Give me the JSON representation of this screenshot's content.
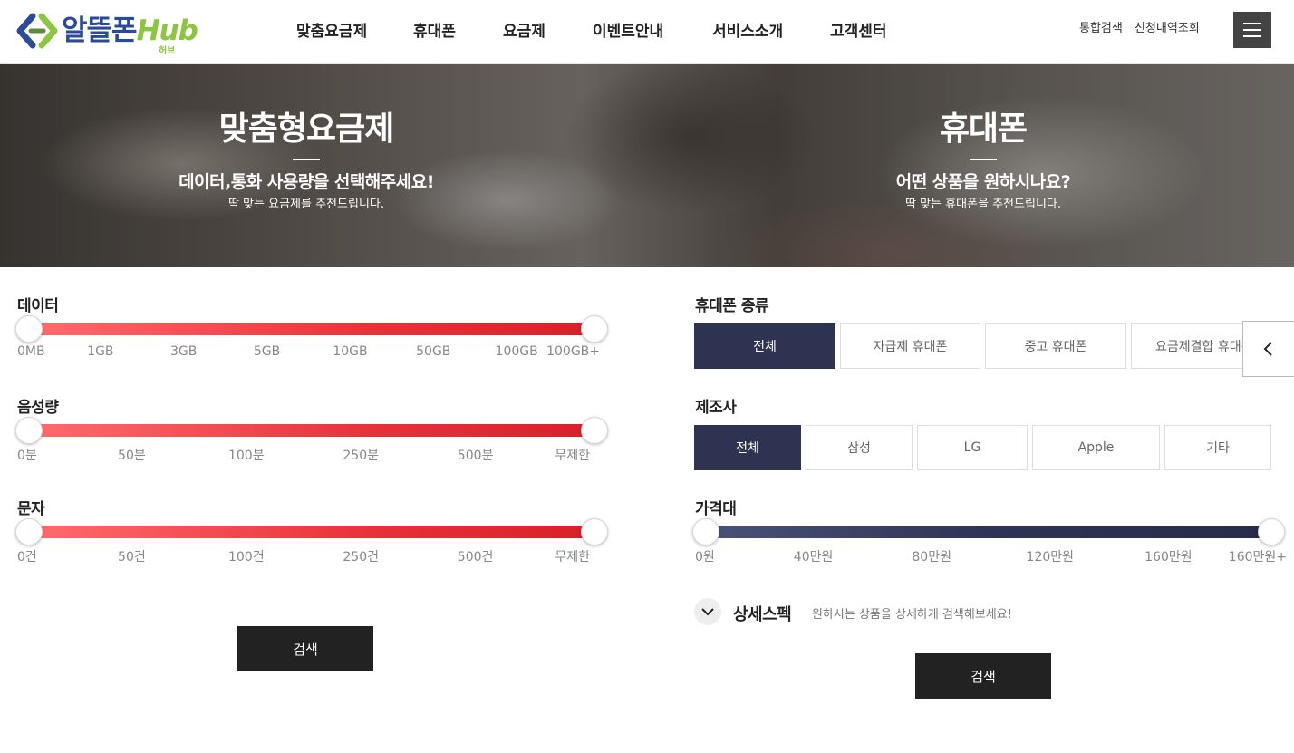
{
  "brand": {
    "name": "알뜰폰",
    "hub": "Hub",
    "sub": "허브"
  },
  "nav": [
    "맞춤요금제",
    "휴대폰",
    "요금제",
    "이벤트안내",
    "서비스소개",
    "고객센터"
  ],
  "util": {
    "search": "통합검색",
    "history": "신청내역조회"
  },
  "hero": {
    "left": {
      "title": "맞춤형요금제",
      "subtitle": "데이터,통화 사용량을 선택해주세요!",
      "desc": "딱 맞는 요금제를 추천드립니다."
    },
    "right": {
      "title": "휴대폰",
      "subtitle": "어떤 상품을 원하시나요?",
      "desc": "딱 맞는 휴대폰을 추천드립니다."
    }
  },
  "plan": {
    "data": {
      "label": "데이터",
      "ticks": [
        "0MB",
        "1GB",
        "3GB",
        "5GB",
        "10GB",
        "50GB",
        "100GB",
        "100GB+"
      ],
      "range": [
        0,
        1
      ]
    },
    "voice": {
      "label": "음성량",
      "ticks": [
        "0분",
        "50분",
        "100분",
        "250분",
        "500분",
        "무제한"
      ],
      "range": [
        0,
        1
      ]
    },
    "sms": {
      "label": "문자",
      "ticks": [
        "0건",
        "50건",
        "100건",
        "250건",
        "500건",
        "무제한"
      ],
      "range": [
        0,
        1
      ]
    },
    "search_label": "검색"
  },
  "phone": {
    "type": {
      "label": "휴대폰 종류",
      "options": [
        "전체",
        "자급제 휴대폰",
        "중고 휴대폰",
        "요금제결합 휴대폰"
      ],
      "selected": "전체"
    },
    "maker": {
      "label": "제조사",
      "options": [
        "전체",
        "삼성",
        "LG",
        "Apple",
        "기타"
      ],
      "selected": "전체"
    },
    "price": {
      "label": "가격대",
      "ticks": [
        "0원",
        "40만원",
        "80만원",
        "120만원",
        "160만원",
        "160만원+"
      ],
      "range": [
        0,
        1
      ]
    },
    "detail": {
      "title": "상세스펙",
      "desc": "원하시는 상품을 상세하게 검색해보세요!"
    },
    "search_label": "검색"
  },
  "colors": {
    "accent_red": "#e8323a",
    "accent_navy": "#2e3352",
    "brand_blue": "#2a4a9b",
    "brand_green": "#8cc63f"
  },
  "icons": {
    "menu": "hamburger-icon",
    "prev": "chevron-left-icon",
    "detail": "chevron-down-icon"
  }
}
